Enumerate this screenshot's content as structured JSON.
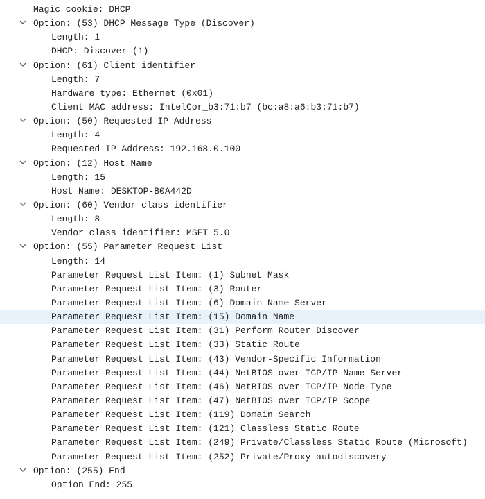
{
  "lines": [
    {
      "level": 0,
      "toggle": false,
      "highlighted": false,
      "text": "Magic cookie: DHCP"
    },
    {
      "level": 0,
      "toggle": true,
      "highlighted": false,
      "text": "Option: (53) DHCP Message Type (Discover)"
    },
    {
      "level": 1,
      "toggle": false,
      "highlighted": false,
      "text": "Length: 1"
    },
    {
      "level": 1,
      "toggle": false,
      "highlighted": false,
      "text": "DHCP: Discover (1)"
    },
    {
      "level": 0,
      "toggle": true,
      "highlighted": false,
      "text": "Option: (61) Client identifier"
    },
    {
      "level": 1,
      "toggle": false,
      "highlighted": false,
      "text": "Length: 7"
    },
    {
      "level": 1,
      "toggle": false,
      "highlighted": false,
      "text": "Hardware type: Ethernet (0x01)"
    },
    {
      "level": 1,
      "toggle": false,
      "highlighted": false,
      "text": "Client MAC address: IntelCor_b3:71:b7 (bc:a8:a6:b3:71:b7)"
    },
    {
      "level": 0,
      "toggle": true,
      "highlighted": false,
      "text": "Option: (50) Requested IP Address"
    },
    {
      "level": 1,
      "toggle": false,
      "highlighted": false,
      "text": "Length: 4"
    },
    {
      "level": 1,
      "toggle": false,
      "highlighted": false,
      "text": "Requested IP Address: 192.168.0.100"
    },
    {
      "level": 0,
      "toggle": true,
      "highlighted": false,
      "text": "Option: (12) Host Name"
    },
    {
      "level": 1,
      "toggle": false,
      "highlighted": false,
      "text": "Length: 15"
    },
    {
      "level": 1,
      "toggle": false,
      "highlighted": false,
      "text": "Host Name: DESKTOP-B0A442D"
    },
    {
      "level": 0,
      "toggle": true,
      "highlighted": false,
      "text": "Option: (60) Vendor class identifier"
    },
    {
      "level": 1,
      "toggle": false,
      "highlighted": false,
      "text": "Length: 8"
    },
    {
      "level": 1,
      "toggle": false,
      "highlighted": false,
      "text": "Vendor class identifier: MSFT 5.0"
    },
    {
      "level": 0,
      "toggle": true,
      "highlighted": false,
      "text": "Option: (55) Parameter Request List"
    },
    {
      "level": 1,
      "toggle": false,
      "highlighted": false,
      "text": "Length: 14"
    },
    {
      "level": 1,
      "toggle": false,
      "highlighted": false,
      "text": "Parameter Request List Item: (1) Subnet Mask"
    },
    {
      "level": 1,
      "toggle": false,
      "highlighted": false,
      "text": "Parameter Request List Item: (3) Router"
    },
    {
      "level": 1,
      "toggle": false,
      "highlighted": false,
      "text": "Parameter Request List Item: (6) Domain Name Server"
    },
    {
      "level": 1,
      "toggle": false,
      "highlighted": true,
      "text": "Parameter Request List Item: (15) Domain Name"
    },
    {
      "level": 1,
      "toggle": false,
      "highlighted": false,
      "text": "Parameter Request List Item: (31) Perform Router Discover"
    },
    {
      "level": 1,
      "toggle": false,
      "highlighted": false,
      "text": "Parameter Request List Item: (33) Static Route"
    },
    {
      "level": 1,
      "toggle": false,
      "highlighted": false,
      "text": "Parameter Request List Item: (43) Vendor-Specific Information"
    },
    {
      "level": 1,
      "toggle": false,
      "highlighted": false,
      "text": "Parameter Request List Item: (44) NetBIOS over TCP/IP Name Server"
    },
    {
      "level": 1,
      "toggle": false,
      "highlighted": false,
      "text": "Parameter Request List Item: (46) NetBIOS over TCP/IP Node Type"
    },
    {
      "level": 1,
      "toggle": false,
      "highlighted": false,
      "text": "Parameter Request List Item: (47) NetBIOS over TCP/IP Scope"
    },
    {
      "level": 1,
      "toggle": false,
      "highlighted": false,
      "text": "Parameter Request List Item: (119) Domain Search"
    },
    {
      "level": 1,
      "toggle": false,
      "highlighted": false,
      "text": "Parameter Request List Item: (121) Classless Static Route"
    },
    {
      "level": 1,
      "toggle": false,
      "highlighted": false,
      "text": "Parameter Request List Item: (249) Private/Classless Static Route (Microsoft)"
    },
    {
      "level": 1,
      "toggle": false,
      "highlighted": false,
      "text": "Parameter Request List Item: (252) Private/Proxy autodiscovery"
    },
    {
      "level": 0,
      "toggle": true,
      "highlighted": false,
      "text": "Option: (255) End"
    },
    {
      "level": 1,
      "toggle": false,
      "highlighted": false,
      "text": "Option End: 255"
    }
  ]
}
